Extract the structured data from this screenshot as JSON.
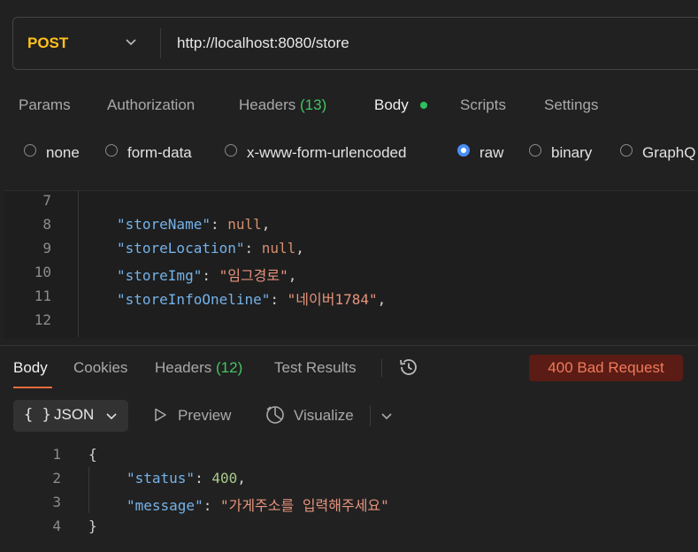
{
  "request": {
    "method": "POST",
    "url": "http://localhost:8080/store",
    "tabs": [
      {
        "label": "Params"
      },
      {
        "label": "Authorization"
      },
      {
        "label": "Headers",
        "count": "(13)"
      },
      {
        "label": "Body"
      },
      {
        "label": "Scripts"
      },
      {
        "label": "Settings"
      }
    ],
    "body_modes": [
      "none",
      "form-data",
      "x-www-form-urlencoded",
      "raw",
      "binary",
      "GraphQ"
    ],
    "selected_body_mode": "raw",
    "editor": {
      "line_numbers": [
        "7",
        "8",
        "9",
        "10",
        "11",
        "12"
      ],
      "lines": [
        {
          "key": "\"storeName\"",
          "value": "null"
        },
        {
          "key": "\"storeLocation\"",
          "value": "null"
        },
        {
          "key": "\"storeImg\"",
          "value": "\"임그경로\""
        },
        {
          "key": "\"storeInfoOneline\"",
          "value": "\"네이버1784\""
        }
      ]
    }
  },
  "response": {
    "tabs": [
      {
        "label": "Body"
      },
      {
        "label": "Cookies"
      },
      {
        "label": "Headers",
        "count": "(12)"
      },
      {
        "label": "Test Results"
      }
    ],
    "status": "400 Bad Request",
    "format": "JSON",
    "preview_label": "Preview",
    "visualize_label": "Visualize",
    "editor": {
      "line_numbers": [
        "1",
        "2",
        "3",
        "4"
      ],
      "open_brace": "{",
      "close_brace": "}",
      "lines": [
        {
          "key": "\"status\"",
          "value": "400"
        },
        {
          "key": "\"message\"",
          "value": "\"가게주소를 입력해주세요\""
        }
      ]
    }
  },
  "colors": {
    "method": "#ffc01e",
    "accent": "#f26b3a",
    "status_error": "#f07a5c",
    "count_green": "#43c466"
  },
  "icons": [
    "chevron-down-icon",
    "history-icon",
    "preview-icon",
    "visualize-icon",
    "curly-braces-icon"
  ]
}
